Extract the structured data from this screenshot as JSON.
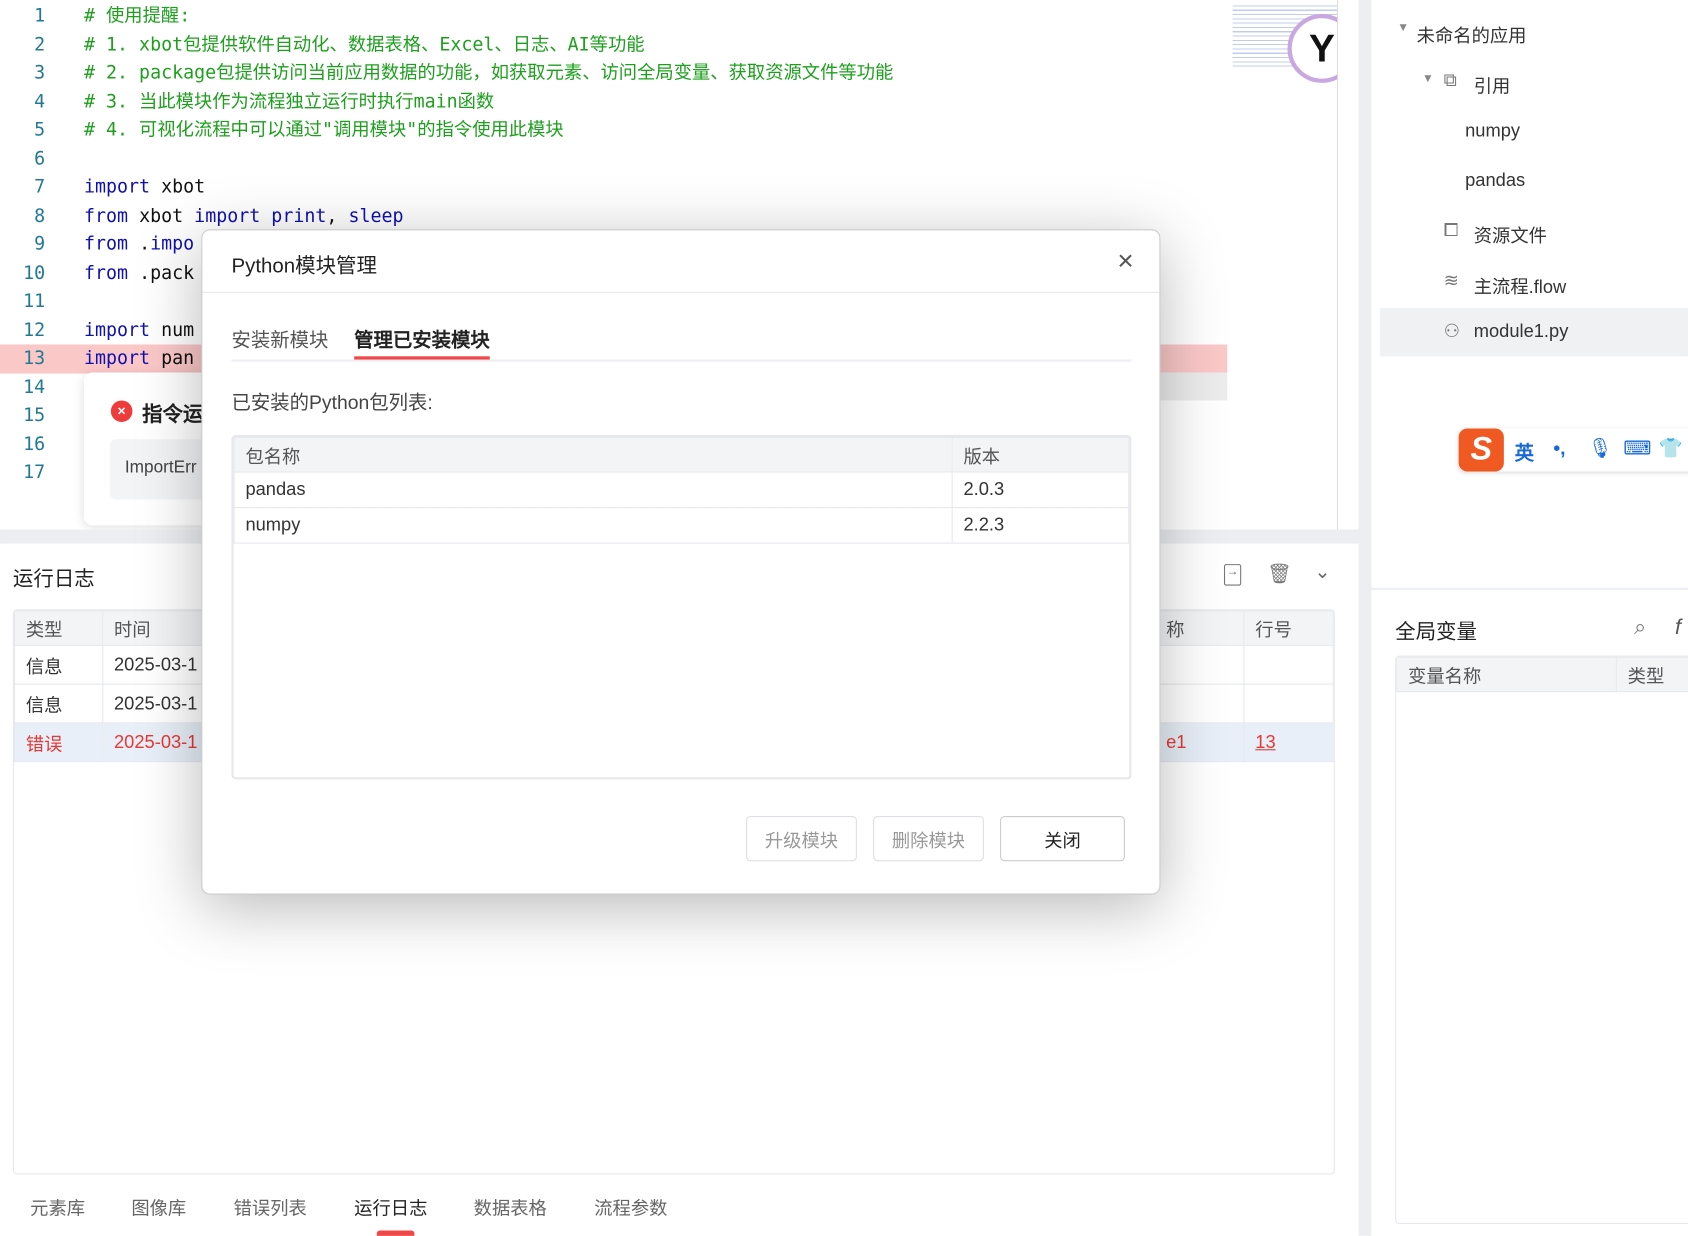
{
  "editor": {
    "lines": [
      {
        "n": "1",
        "parts": [
          [
            "cm",
            "# 使用提醒:"
          ]
        ]
      },
      {
        "n": "2",
        "parts": [
          [
            "cm",
            "# 1. xbot包提供软件自动化、数据表格、Excel、日志、AI等功能"
          ]
        ]
      },
      {
        "n": "3",
        "parts": [
          [
            "cm",
            "# 2. package包提供访问当前应用数据的功能，如获取元素、访问全局变量、获取资源文件等功能"
          ]
        ]
      },
      {
        "n": "4",
        "parts": [
          [
            "cm",
            "# 3. 当此模块作为流程独立运行时执行main函数"
          ]
        ]
      },
      {
        "n": "5",
        "parts": [
          [
            "cm",
            "# 4. 可视化流程中可以通过\"调用模块\"的指令使用此模块"
          ]
        ]
      },
      {
        "n": "6",
        "parts": []
      },
      {
        "n": "7",
        "parts": [
          [
            "kw",
            "import"
          ],
          [
            "id",
            " xbot"
          ]
        ]
      },
      {
        "n": "8",
        "parts": [
          [
            "kw",
            "from"
          ],
          [
            "id",
            " xbot "
          ],
          [
            "kw",
            "import print"
          ],
          [
            "id",
            ", "
          ],
          [
            "kw",
            "sleep"
          ]
        ]
      },
      {
        "n": "9",
        "parts": [
          [
            "kw",
            "from"
          ],
          [
            "id",
            " ."
          ],
          [
            "kw",
            "impo"
          ]
        ]
      },
      {
        "n": "10",
        "parts": [
          [
            "kw",
            "from"
          ],
          [
            "id",
            " .pack"
          ]
        ]
      },
      {
        "n": "11",
        "parts": []
      },
      {
        "n": "12",
        "parts": [
          [
            "kw",
            "import"
          ],
          [
            "id",
            " num"
          ]
        ]
      },
      {
        "n": "13",
        "parts": [
          [
            "kw",
            "import"
          ],
          [
            "id",
            " pan"
          ]
        ]
      },
      {
        "n": "14",
        "parts": []
      },
      {
        "n": "15",
        "parts": []
      },
      {
        "n": "16",
        "parts": []
      },
      {
        "n": "17",
        "parts": []
      }
    ],
    "error_title": "指令运",
    "error_text": "ImportErr"
  },
  "log": {
    "title": "运行日志",
    "columns": [
      "类型",
      "时间",
      "称",
      "行号"
    ],
    "rows": [
      {
        "type": "信息",
        "time": "2025-03-1",
        "name": "",
        "line": ""
      },
      {
        "type": "信息",
        "time": "2025-03-1",
        "name": "",
        "line": ""
      },
      {
        "type": "错误",
        "time": "2025-03-1",
        "name": "e1",
        "line": "13",
        "error": true
      }
    ]
  },
  "bottom_tabs": [
    "元素库",
    "图像库",
    "错误列表",
    "运行日志",
    "数据表格",
    "流程参数"
  ],
  "active_tab": "运行日志",
  "tree": {
    "root": "未命名的应用",
    "ref": "引用",
    "refs": [
      "numpy",
      "pandas"
    ],
    "resources": "资源文件",
    "flow": "主流程.flow",
    "module": "module1.py"
  },
  "ime": {
    "lang": "英",
    "punct": "•,"
  },
  "globals": {
    "title": "全局变量",
    "columns": [
      "变量名称",
      "类型"
    ]
  },
  "modal": {
    "title": "Python模块管理",
    "tabs": [
      "安装新模块",
      "管理已安装模块"
    ],
    "active_tab": 1,
    "list_label": "已安装的Python包列表:",
    "columns": [
      "包名称",
      "版本"
    ],
    "packages": [
      {
        "name": "pandas",
        "version": "2.0.3"
      },
      {
        "name": "numpy",
        "version": "2.2.3"
      }
    ],
    "buttons": {
      "upgrade": "升级模块",
      "delete": "删除模块",
      "close": "关闭"
    }
  },
  "colors": {
    "accent": "#f04848",
    "error": "#e53935",
    "keyword": "#1010b0",
    "comment": "#1ea01e"
  }
}
